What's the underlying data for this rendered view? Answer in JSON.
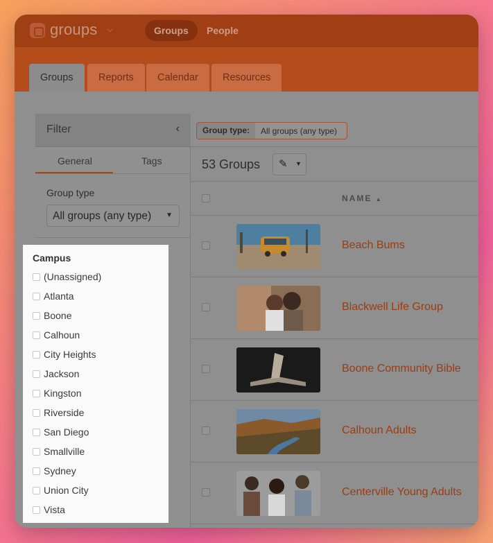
{
  "app": {
    "name": "groups"
  },
  "topnav": {
    "items": [
      {
        "label": "Groups",
        "active": true
      },
      {
        "label": "People",
        "active": false
      }
    ]
  },
  "tabs": [
    {
      "label": "Groups",
      "active": true
    },
    {
      "label": "Reports",
      "active": false
    },
    {
      "label": "Calendar",
      "active": false
    },
    {
      "label": "Resources",
      "active": false
    }
  ],
  "filter": {
    "title": "Filter",
    "collapse_icon": "chevron-left-icon",
    "subtabs": [
      {
        "label": "General",
        "active": true
      },
      {
        "label": "Tags",
        "active": false
      }
    ],
    "group_type_label": "Group type",
    "group_type_value": "All groups (any type)"
  },
  "campus": {
    "title": "Campus",
    "options": [
      "(Unassigned)",
      "Atlanta",
      "Boone",
      "Calhoun",
      "City Heights",
      "Jackson",
      "Kingston",
      "Riverside",
      "San Diego",
      "Smallville",
      "Sydney",
      "Union City",
      "Vista"
    ]
  },
  "active_filter": {
    "key": "Group type:",
    "value": "All groups (any type)"
  },
  "results": {
    "count_label": "53 Groups"
  },
  "table": {
    "name_header": "NAME",
    "sort_icon": "sort-ascending-icon",
    "rows": [
      {
        "name": "Beach Bums"
      },
      {
        "name": "Blackwell Life Group"
      },
      {
        "name": "Boone Community Bible"
      },
      {
        "name": "Calhoun Adults"
      },
      {
        "name": "Centerville Young Adults"
      }
    ]
  },
  "colors": {
    "accent": "#a13f14",
    "highlight_panel": "#fafafa",
    "overlay": "#8f8f8f"
  }
}
